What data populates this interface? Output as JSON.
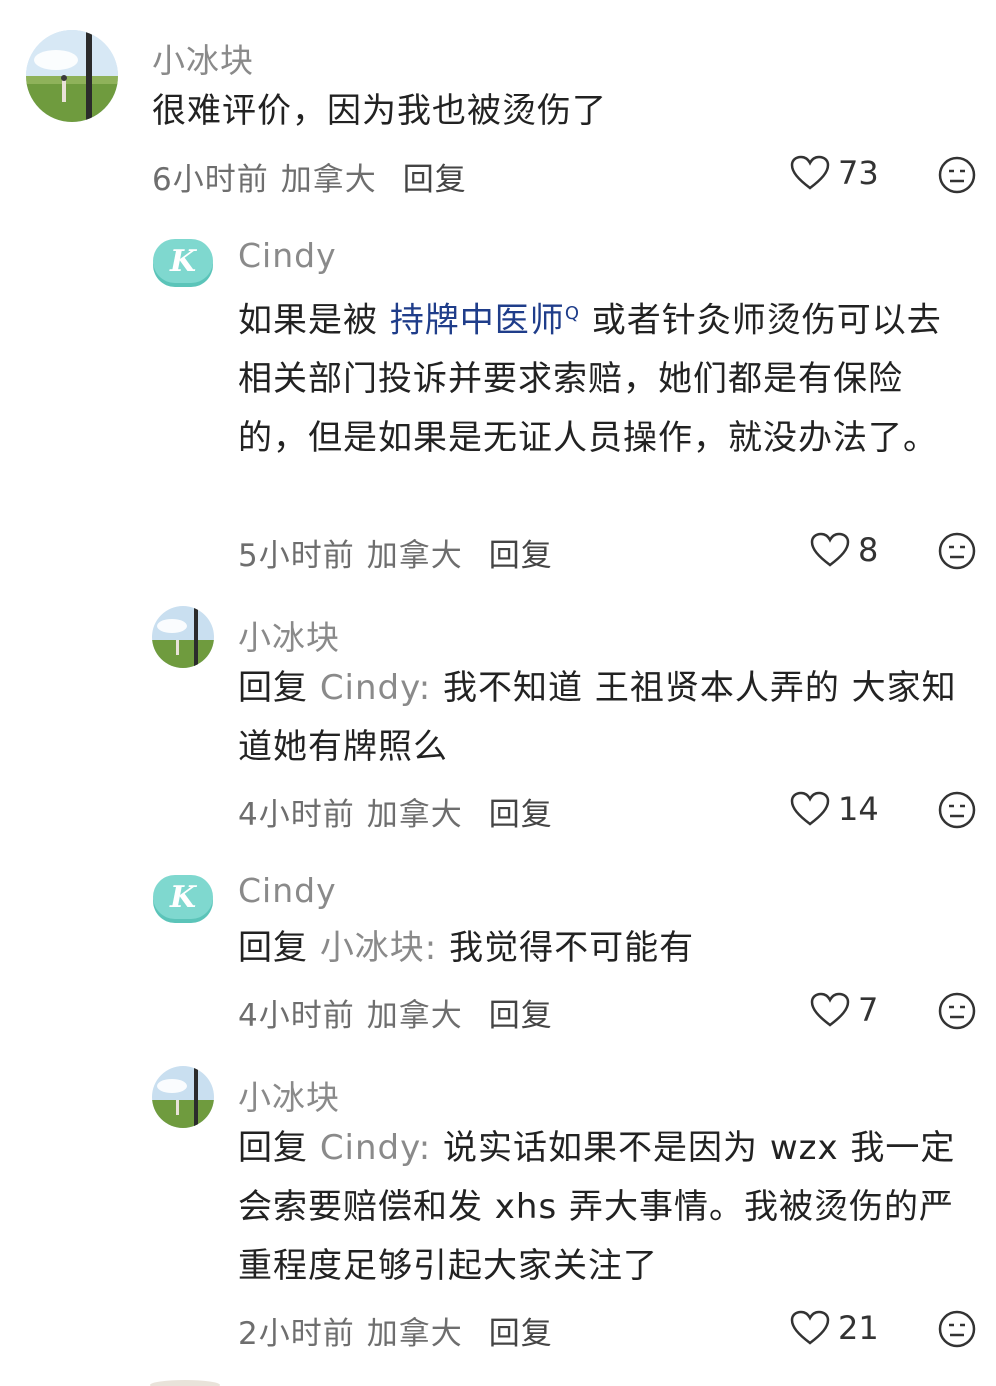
{
  "comments": [
    {
      "username": "小冰块",
      "text_parts": [
        "很难评价，因为我也被烫伤了"
      ],
      "time": "6小时前",
      "location": "加拿大",
      "reply_label": "回复",
      "likes": "73",
      "avatar_icon": "field-photo-avatar"
    },
    {
      "username": "Cindy",
      "text_before": "如果是被 ",
      "link_text": "持牌中医师",
      "link_suffix": "Q",
      "text_after": " 或者针灸师烫伤可以去相关部门投诉并要求索赔，她们都是有保险的，但是如果是无证人员操作，就没办法了。",
      "time": "5小时前",
      "location": "加拿大",
      "reply_label": "回复",
      "likes": "8",
      "avatar_letter": "K"
    },
    {
      "username": "小冰块",
      "reply_prefix": "回复 ",
      "reply_target": "Cindy:",
      "text": " 我不知道 王祖贤本人弄的 大家知道她有牌照么",
      "time": "4小时前",
      "location": "加拿大",
      "reply_label": "回复",
      "likes": "14"
    },
    {
      "username": "Cindy",
      "reply_prefix": "回复 ",
      "reply_target": "小冰块:",
      "text": " 我觉得不可能有",
      "time": "4小时前",
      "location": "加拿大",
      "reply_label": "回复",
      "likes": "7",
      "avatar_letter": "K"
    },
    {
      "username": "小冰块",
      "reply_prefix": "回复 ",
      "reply_target": "Cindy:",
      "text": " 说实话如果不是因为 wzx 我一定会索要赔偿和发 xhs 弄大事情。我被烫伤的严重程度足够引起大家关注了",
      "time": "2小时前",
      "location": "加拿大",
      "reply_label": "回复",
      "likes": "21"
    }
  ],
  "colors": {
    "username": "#8a8a8a",
    "link": "#1f3d8a",
    "avatar_k": "#7fd8cf"
  }
}
